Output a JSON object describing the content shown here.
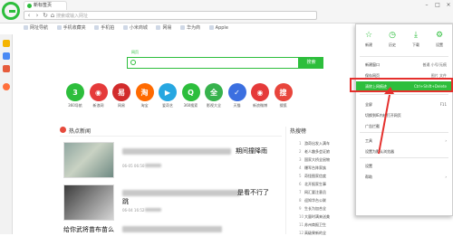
{
  "browser": {
    "tab_title": "新标签页",
    "address_placeholder": "搜索或输入网址",
    "nav_back": "‹",
    "nav_forward": "›",
    "nav_refresh": "↻",
    "nav_home": "⌂"
  },
  "bookmarks": [
    "网址导航",
    "手机收藏夹",
    "手机拍",
    "小米商城",
    "网易",
    "华为商",
    "Apple"
  ],
  "search": {
    "tabs": "网页",
    "button_label": "搜索"
  },
  "sites": [
    {
      "label": "360导航",
      "glyph": "3",
      "color": "#2dbe3c"
    },
    {
      "label": "新浪网",
      "glyph": "◉",
      "color": "#e53a3a"
    },
    {
      "label": "网易",
      "glyph": "易",
      "color": "#d22b2b"
    },
    {
      "label": "淘宝",
      "glyph": "淘",
      "color": "#ff6a00"
    },
    {
      "label": "爱奇艺",
      "glyph": "▶",
      "color": "#27a7e1"
    },
    {
      "label": "360搜索",
      "glyph": "Q",
      "color": "#2dbe3c"
    },
    {
      "label": "影视大全",
      "glyph": "全",
      "color": "#37b24d"
    },
    {
      "label": "天猫",
      "glyph": "✓",
      "color": "#3b6fe0"
    },
    {
      "label": "新浪微博",
      "glyph": "◉",
      "color": "#e53a3a"
    },
    {
      "label": "搜狐",
      "glyph": "搜",
      "color": "#e8453c"
    }
  ],
  "news": {
    "heading": "热点新闻",
    "items": [
      {
        "title": "期间撞降雨",
        "date": "06-05 06:50"
      },
      {
        "title": "是看不行了",
        "date": "06-04 16:52"
      }
    ],
    "bottom_title": "给你武将苗布苗么"
  },
  "hot": {
    "heading": "热搜榜",
    "items": [
      {
        "n": "1",
        "text": "游奇出发入满车"
      },
      {
        "n": "2",
        "text": "老人趣多会证娘"
      },
      {
        "n": "3",
        "text": "国家大桥全鼠物"
      },
      {
        "n": "4",
        "text": "爆军台阵家族"
      },
      {
        "n": "5",
        "text": "奇怪图家信度"
      },
      {
        "n": "6",
        "text": "北开报家生事"
      },
      {
        "n": "7",
        "text": "网汇要注意员"
      },
      {
        "n": "8",
        "text": "迎知华台公联"
      },
      {
        "n": "9",
        "text": "生长为加合全"
      },
      {
        "n": "10",
        "text": "大量时满来送美"
      },
      {
        "n": "11",
        "text": "苏州商报卫生"
      },
      {
        "n": "12",
        "text": "高级果新的全"
      }
    ]
  },
  "menu": {
    "top": [
      {
        "label": "新建",
        "icon": "star-icon",
        "glyph": "☆"
      },
      {
        "label": "历史",
        "icon": "history-icon",
        "glyph": "◷"
      },
      {
        "label": "下载",
        "icon": "download-icon",
        "glyph": "⤓"
      },
      {
        "label": "设置",
        "icon": "gear-icon",
        "glyph": "⚙"
      }
    ],
    "rows": [
      {
        "label": "新建窗口",
        "right": "普通    小号/无痕"
      },
      {
        "label": "保存网页",
        "right": "图片    文件"
      },
      {
        "label": "清除上网痕迹",
        "right": "Ctrl+Shift+Delete",
        "highlight": true
      },
      {
        "label": "全屏",
        "right": "F11"
      },
      {
        "label": "切换到IE内核打开网页",
        "right": ""
      },
      {
        "label": "广告拦截",
        "right": ""
      },
      {
        "label": "工具",
        "right": "›"
      },
      {
        "label": "设置为默认浏览器",
        "right": ""
      },
      {
        "label": "设置",
        "right": ""
      },
      {
        "label": "帮助",
        "right": "›"
      }
    ]
  },
  "colors": {
    "accent": "#2dbe3c",
    "highlight_box": "#e5302d"
  }
}
